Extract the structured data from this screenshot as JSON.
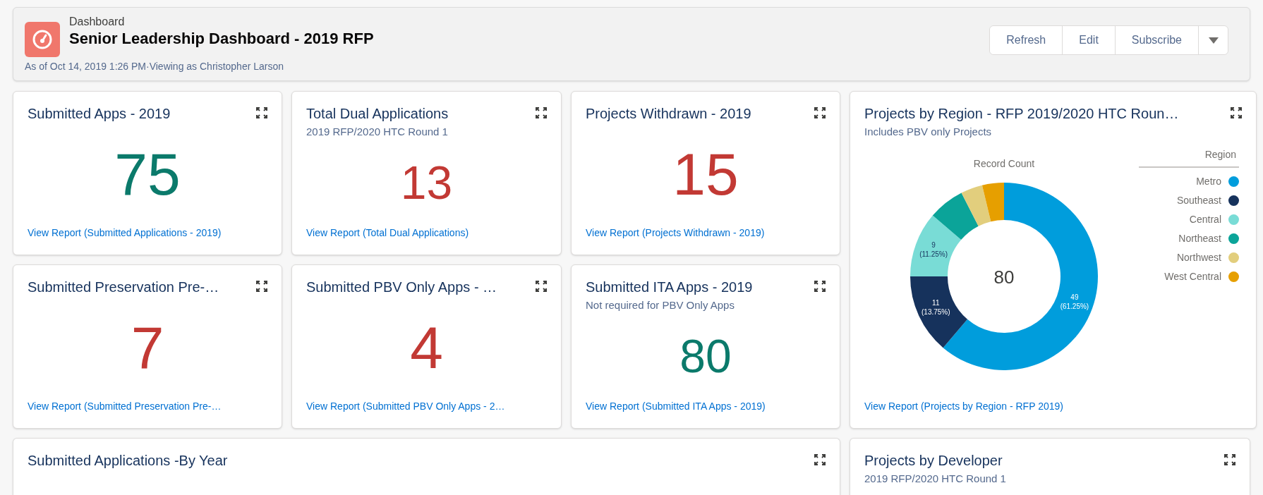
{
  "header": {
    "object_type": "Dashboard",
    "title": "Senior Leadership Dashboard - 2019 RFP",
    "subtitle": "As of Oct 14, 2019 1:26 PM·Viewing as Christopher Larson",
    "buttons": [
      "Refresh",
      "Edit",
      "Subscribe"
    ]
  },
  "metric_tiles": [
    {
      "title": "Submitted Apps - 2019",
      "value": "75",
      "color": "#0b7a6b",
      "link": "View Report (Submitted Applications - 2019)"
    },
    {
      "title": "Total Dual Applications",
      "subtitle": "2019 RFP/2020 HTC Round 1",
      "value": "13",
      "color": "#c23934",
      "link": "View Report (Total Dual Applications)"
    },
    {
      "title": "Projects Withdrawn - 2019",
      "value": "15",
      "color": "#c23934",
      "link": "View Report (Projects Withdrawn - 2019)"
    },
    {
      "title": "Submitted Preservation Pre-…",
      "value": "7",
      "color": "#c23934",
      "link": "View Report (Submitted Preservation Pre-…"
    },
    {
      "title": "Submitted PBV Only Apps - …",
      "value": "4",
      "color": "#c23934",
      "link": "View Report (Submitted PBV Only Apps - 2…"
    },
    {
      "title": "Submitted ITA Apps - 2019",
      "subtitle": "Not required for PBV Only Apps",
      "value": "80",
      "color": "#0b7a6b",
      "link": "View Report (Submitted ITA Apps - 2019)"
    }
  ],
  "region_chart": {
    "title": "Projects by Region - RFP 2019/2020 HTC Roun…",
    "subtitle": "Includes PBV only Projects",
    "total": "80",
    "link": "View Report (Projects by Region - RFP 2019)",
    "chart_data": {
      "type": "donut",
      "title": "Record Count",
      "categories": [
        "Metro",
        "Southeast",
        "Central",
        "Northeast",
        "Northwest",
        "West Central"
      ],
      "series": [
        {
          "values": [
            61.25,
            13.75,
            11.25,
            6.25,
            3.75,
            3.75
          ]
        }
      ],
      "colors": [
        "#009ddc",
        "#16325c",
        "#79dcd6",
        "#0ba499",
        "#e2ce7d",
        "#e69f00"
      ],
      "legend": {
        "title": "Region"
      },
      "value_labels": [
        "49 (61.25%)",
        "11 (13.75%)",
        "9 (11.25%)",
        null,
        null,
        null
      ]
    }
  },
  "bottom_cards": [
    {
      "title": "Submitted Applications -By Year"
    },
    {
      "title": "Projects by Developer",
      "subtitle": "2019 RFP/2020 HTC Round 1"
    }
  ]
}
